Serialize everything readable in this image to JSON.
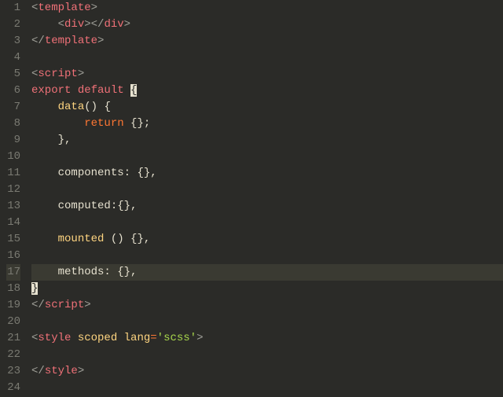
{
  "gutter": [
    "1",
    "2",
    "3",
    "4",
    "5",
    "6",
    "7",
    "8",
    "9",
    "10",
    "11",
    "12",
    "13",
    "14",
    "15",
    "16",
    "17",
    "18",
    "19",
    "20",
    "21",
    "22",
    "23",
    "24"
  ],
  "code": {
    "l1": {
      "a": "<",
      "t": "template",
      "b": ">"
    },
    "l2": {
      "indent": "    ",
      "a": "<",
      "t": "div",
      "b": "></",
      "t2": "div",
      "c": ">"
    },
    "l3": {
      "a": "</",
      "t": "template",
      "b": ">"
    },
    "l5": {
      "a": "<",
      "t": "script",
      "b": ">"
    },
    "l6": {
      "kw1": "export",
      "sp": " ",
      "kw2": "default",
      "sp2": " ",
      "br": "{"
    },
    "l7": {
      "indent": "    ",
      "fn": "data",
      "p": "()",
      "sp": " ",
      "br": "{"
    },
    "l8": {
      "indent": "        ",
      "ret": "return",
      "sp": " ",
      "br": "{}",
      "sc": ";"
    },
    "l9": {
      "indent": "    ",
      "br": "}",
      "c": ","
    },
    "l11": {
      "indent": "    ",
      "prop": "components",
      "col": ":",
      "sp": " ",
      "br": "{}",
      "c": ","
    },
    "l13": {
      "indent": "    ",
      "prop": "computed",
      "col": ":",
      "br": "{}",
      "c": ","
    },
    "l15": {
      "indent": "    ",
      "fn": "mounted",
      "sp": " ",
      "p": "()",
      "sp2": " ",
      "br": "{}",
      "c": ","
    },
    "l17": {
      "indent": "    ",
      "prop": "methods",
      "col": ":",
      "sp": " ",
      "br": "{}",
      "c": ","
    },
    "l18": {
      "br": "}"
    },
    "l19": {
      "a": "</",
      "t": "script",
      "b": ">"
    },
    "l21": {
      "a": "<",
      "t": "style",
      "sp": " ",
      "attr1": "scoped",
      "sp2": " ",
      "attr2": "lang",
      "eq": "=",
      "str": "'scss'",
      "b": ">"
    },
    "l23": {
      "a": "</",
      "t": "style",
      "b": ">"
    }
  }
}
